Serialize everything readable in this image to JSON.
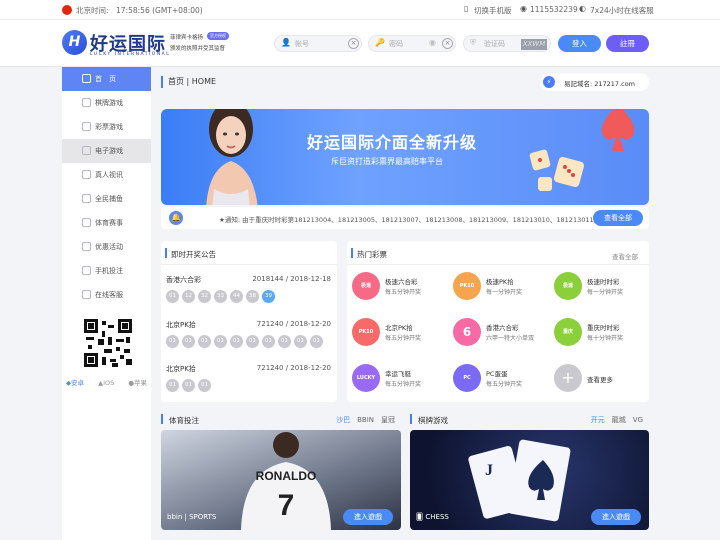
{
  "topbar": {
    "time_label": "北京时间:",
    "time_value": "17:58:56 (GMT+08:00)",
    "mobile": "切换手机版",
    "qq": "1115532239",
    "service": "7x24小时在线客服"
  },
  "header": {
    "logo_icon": "H",
    "logo_name": "好运国际",
    "logo_sub": "LUCKY INTERNATIONAL",
    "slogan1": "菲律宾卡格扬",
    "slogan_badge": "官方授权",
    "slogan2": "颁发的执照并受其监督",
    "account_placeholder": "帐号",
    "password_placeholder": "密码",
    "captcha_placeholder": "验证码",
    "captcha_code": "XXWM",
    "login": "登入",
    "register": "註冊"
  },
  "sidebar": {
    "items": [
      {
        "label": "首　页"
      },
      {
        "label": "棋牌游戏"
      },
      {
        "label": "彩票游戏"
      },
      {
        "label": "电子游戏"
      },
      {
        "label": "真人视讯"
      },
      {
        "label": "全民捕鱼"
      },
      {
        "label": "体育赛事"
      },
      {
        "label": "优惠活动"
      },
      {
        "label": "手机投注"
      },
      {
        "label": "在线客服"
      }
    ],
    "apps": {
      "android": "安卓",
      "ios": "IOS",
      "pingguo": "苹果"
    }
  },
  "breadcrumb": {
    "text": "首页 | HOME"
  },
  "domain": {
    "icon": "⚡",
    "text": "易記域名: 217217.com"
  },
  "banner": {
    "title": "好运国际介面全新升级",
    "subtitle": "斥巨资打造彩票界最高赔率平台"
  },
  "notice": {
    "bell": "🔔",
    "text": "★通知: 由于重庆时时彩第181213004、181213005、181213007、181213008、181213009、181213010、181213011",
    "button": "查看全部"
  },
  "lottery": {
    "title": "即时开奖公告",
    "rows": [
      {
        "name": "香港六合彩",
        "issue": "2018144 / 2018-12-18",
        "balls": [
          "01",
          "12",
          "32",
          "33",
          "44",
          "38",
          "39"
        ]
      },
      {
        "name": "北京PK拾",
        "issue": "721240 / 2018-12-20",
        "balls": [
          "01",
          "01",
          "01",
          "01",
          "01",
          "01",
          "01",
          "01",
          "01",
          "01"
        ]
      },
      {
        "name": "北京PK拾",
        "issue": "721240 / 2018-12-20",
        "balls": [
          "01",
          "01",
          "01"
        ]
      }
    ]
  },
  "hot": {
    "title": "热门彩票",
    "more": "查看全部",
    "items": [
      {
        "icon": "极速",
        "name": "极速六合彩",
        "sub": "每五分钟开奖",
        "color": "#f76a86"
      },
      {
        "icon": "PK10",
        "name": "极速PK拾",
        "sub": "每一分钟开奖",
        "color": "#f7a44f"
      },
      {
        "icon": "极速",
        "name": "极速时时彩",
        "sub": "每一分钟开奖",
        "color": "#8bcf3b"
      },
      {
        "icon": "PK10",
        "name": "北京PK拾",
        "sub": "每五分钟开奖",
        "color": "#f76a6a"
      },
      {
        "icon": "6",
        "name": "香港六合彩",
        "sub": "六甲一特大小单双",
        "color": "#f76aa5"
      },
      {
        "icon": "重庆",
        "name": "重庆时时彩",
        "sub": "每十分钟开奖",
        "color": "#8bcf3b"
      },
      {
        "icon": "LUCKY",
        "name": "幸运飞艇",
        "sub": "每五分钟开奖",
        "color": "#9a6af5"
      },
      {
        "icon": "PC",
        "name": "PC蛋蛋",
        "sub": "每五分钟开奖",
        "color": "#7a6af5"
      },
      {
        "icon": "+",
        "name": "查看更多",
        "sub": "",
        "color": "#c9c9cf"
      }
    ]
  },
  "sports": {
    "title": "体育投注",
    "tabs": [
      "沙巴",
      "BBIN",
      "皇冠"
    ],
    "tag": "bbin | SPORTS",
    "button": "進入遊戲",
    "jersey": "RONALDO"
  },
  "chess": {
    "title": "棋牌游戏",
    "tabs": [
      "开元",
      "龍城",
      "VG"
    ],
    "tag": "CHESS",
    "button": "進入遊戲"
  }
}
